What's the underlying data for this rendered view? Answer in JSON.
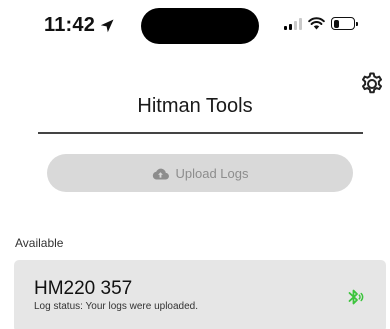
{
  "status_bar": {
    "time": "11:42",
    "location_icon": "location-arrow-icon",
    "signal_icon": "cellular-signal-icon",
    "signal_bars_active": 2,
    "wifi_icon": "wifi-icon",
    "battery_icon": "battery-icon",
    "battery_level": 0.3
  },
  "header": {
    "title": "Hitman Tools",
    "settings_icon": "gear-icon"
  },
  "upload": {
    "label": "Upload Logs",
    "icon": "cloud-upload-icon",
    "enabled": false
  },
  "available": {
    "section_label": "Available",
    "devices": [
      {
        "name": "HM220 357",
        "status": "Log status: Your logs were uploaded.",
        "icon": "bluetooth-connected-icon"
      }
    ]
  },
  "colors": {
    "background": "#ffffff",
    "button_disabled_bg": "#d9d9d9",
    "button_disabled_text": "#8d8d8d",
    "card_bg": "#e6e6e6",
    "bluetooth_green": "#3cc43c",
    "divider": "#444444"
  }
}
